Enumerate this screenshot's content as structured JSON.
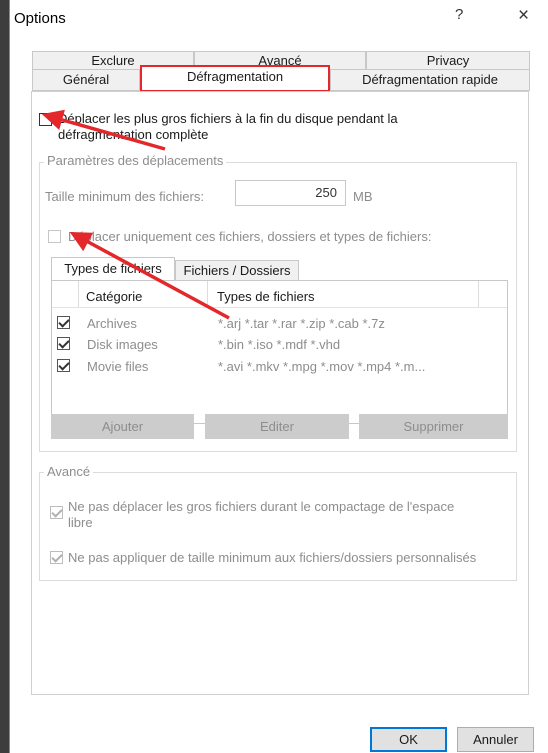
{
  "window": {
    "title": "Options",
    "help": "?",
    "close": "×"
  },
  "tabs": {
    "back_row": [
      "Exclure",
      "Avancé",
      "Privacy"
    ],
    "front_row": [
      "Général",
      "Défragmentation",
      "Défragmentation rapide"
    ],
    "selected": "Défragmentation"
  },
  "move_large": {
    "label_line1": "Déplacer les plus gros fichiers à la fin du disque pendant la",
    "label_line2": "défragmentation complète",
    "checked": false
  },
  "move_settings": {
    "title": "Paramètres des déplacements",
    "min_size_label": "Taille minimum des fichiers:",
    "min_size_value": "250",
    "min_size_unit": "MB",
    "only_these_label": "Déplacer uniquement ces fichiers, dossiers et types de fichiers:",
    "only_these_checked": false,
    "inner_tabs": [
      "Types de fichiers",
      "Fichiers / Dossiers"
    ],
    "columns": [
      "Catégorie",
      "Types de fichiers"
    ],
    "rows": [
      {
        "checked": true,
        "category": "Archives",
        "types": "*.arj *.tar *.rar *.zip *.cab *.7z"
      },
      {
        "checked": true,
        "category": "Disk images",
        "types": "*.bin *.iso *.mdf *.vhd"
      },
      {
        "checked": true,
        "category": "Movie files",
        "types": "*.avi *.mkv *.mpg *.mov *.mp4 *.m..."
      }
    ],
    "buttons": {
      "add": "Ajouter",
      "edit": "Editer",
      "delete": "Supprimer"
    }
  },
  "advanced": {
    "title": "Avancé",
    "opt1_line1": "Ne pas déplacer les gros fichiers durant le compactage de l'espace",
    "opt1_line2": "libre",
    "opt1_checked": true,
    "opt2": "Ne pas appliquer de taille minimum aux fichiers/dossiers personnalisés",
    "opt2_checked": true
  },
  "footer": {
    "ok": "OK",
    "cancel": "Annuler"
  },
  "colors": {
    "highlight": "#e3272a",
    "focus": "#0078d7",
    "disabled_text": "#8d8d8d"
  }
}
